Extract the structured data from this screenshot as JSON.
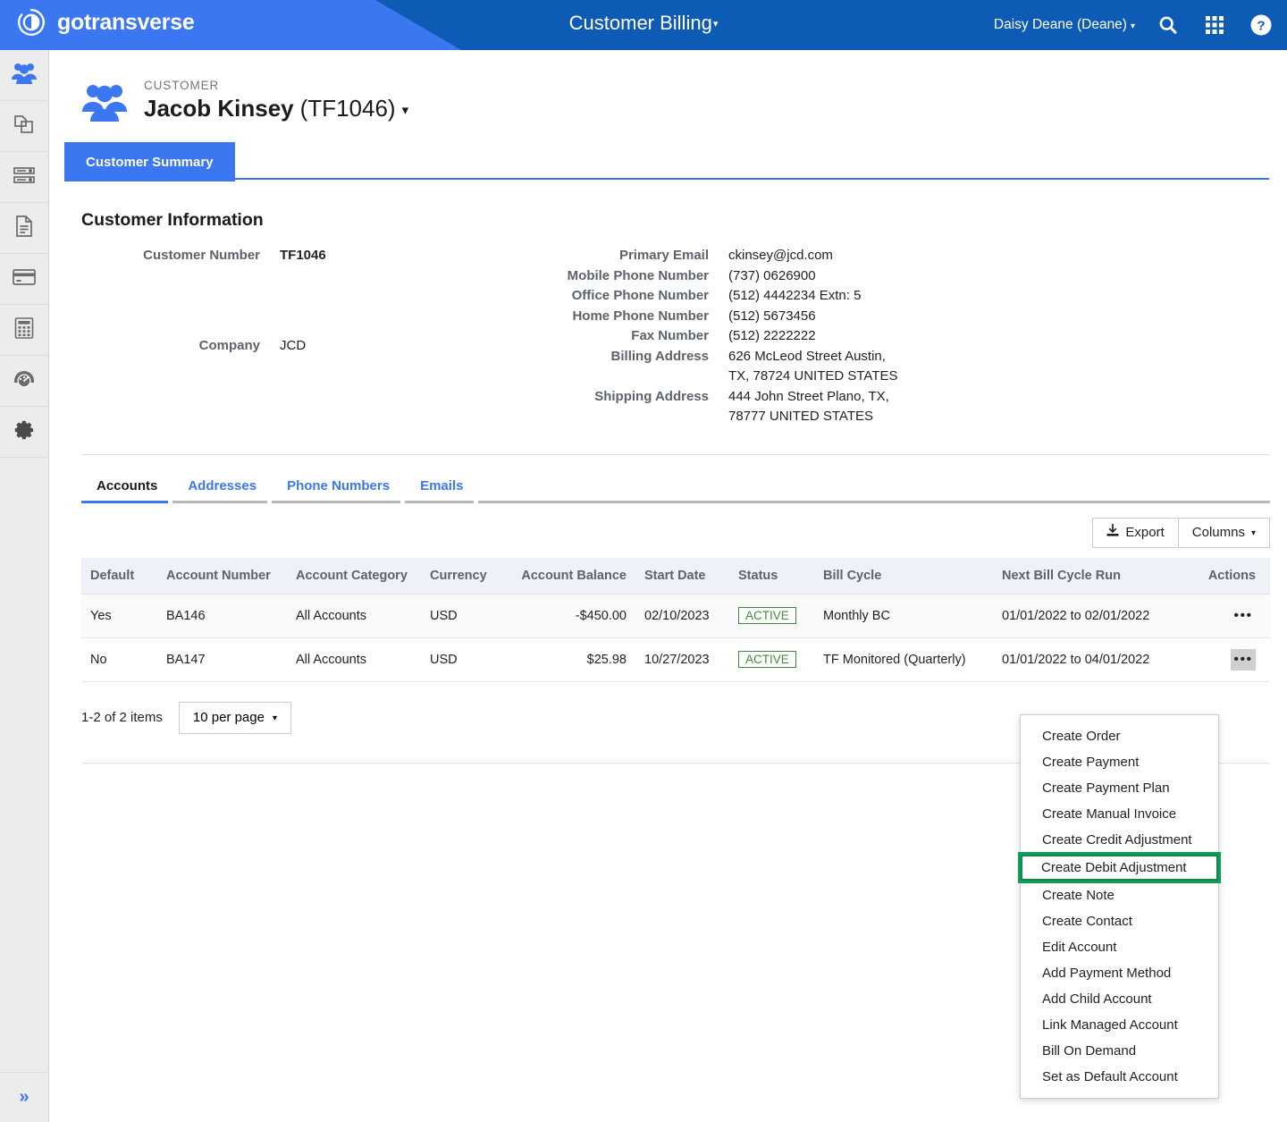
{
  "brand": {
    "name": "gotransverse",
    "logo_icon": "gotransverse-circle-logo"
  },
  "topbar": {
    "app_title": "Customer Billing",
    "app_title_caret": "▾",
    "user": "Daisy Deane (Deane)",
    "user_caret": "▾",
    "icons": [
      "search-icon",
      "apps-grid-icon",
      "help-icon"
    ],
    "colors": {
      "left_wedge": "#3b77f0",
      "right": "#0d5bb5"
    }
  },
  "rail": {
    "items": [
      {
        "name": "customers",
        "icon": "people-icon",
        "active": true
      },
      {
        "name": "products",
        "icon": "copy-documents-icon",
        "active": false
      },
      {
        "name": "billing",
        "icon": "server-stack-icon",
        "active": false
      },
      {
        "name": "invoices",
        "icon": "document-icon",
        "active": false
      },
      {
        "name": "payments",
        "icon": "credit-card-icon",
        "active": false
      },
      {
        "name": "accounting",
        "icon": "calculator-icon",
        "active": false
      },
      {
        "name": "reports",
        "icon": "gauge-icon",
        "active": false
      },
      {
        "name": "settings",
        "icon": "gear-icon",
        "active": false
      }
    ],
    "expand_glyph": "»"
  },
  "customer": {
    "eyebrow": "CUSTOMER",
    "name": "Jacob Kinsey",
    "number_paren": "(TF1046)",
    "caret": "▾",
    "avatar_icon": "people-icon"
  },
  "main_tab": {
    "label": "Customer Summary"
  },
  "info": {
    "heading": "Customer Information",
    "left": [
      {
        "label": "Customer Number",
        "value": "TF1046",
        "bold": true
      },
      {
        "label": "Company",
        "value": "JCD",
        "bold": false
      }
    ],
    "right": [
      {
        "label": "Primary Email",
        "value": "ckinsey@jcd.com"
      },
      {
        "label": "Mobile Phone Number",
        "value": "(737) 0626900"
      },
      {
        "label": "Office Phone Number",
        "value": "(512) 4442234 Extn: 5"
      },
      {
        "label": "Home Phone Number",
        "value": "(512) 5673456"
      },
      {
        "label": "Fax Number",
        "value": "(512) 2222222"
      },
      {
        "label": "Billing Address",
        "value": "626 McLeod Street Austin, TX, 78724 UNITED STATES"
      },
      {
        "label": "Shipping Address",
        "value": "444 John Street Plano, TX, 78777 UNITED STATES"
      }
    ]
  },
  "subtabs": [
    {
      "label": "Accounts",
      "active": true
    },
    {
      "label": "Addresses",
      "active": false
    },
    {
      "label": "Phone Numbers",
      "active": false
    },
    {
      "label": "Emails",
      "active": false
    }
  ],
  "toolbar": {
    "export_label": "Export",
    "export_icon": "download-icon",
    "columns_label": "Columns",
    "columns_caret": "▾"
  },
  "table": {
    "columns": [
      "Default",
      "Account Number",
      "Account Category",
      "Currency",
      "Account Balance",
      "Start Date",
      "Status",
      "Bill Cycle",
      "Next Bill Cycle Run",
      "Actions"
    ],
    "rows": [
      {
        "default": "Yes",
        "account_number": "BA146",
        "account_category": "All Accounts",
        "currency": "USD",
        "account_balance": "-$450.00",
        "start_date": "02/10/2023",
        "status": "ACTIVE",
        "bill_cycle": "Monthly BC",
        "next_bill_cycle_run": "01/01/2022 to 02/01/2022",
        "actions_glyph": "•••",
        "actions_open": false
      },
      {
        "default": "No",
        "account_number": "BA147",
        "account_category": "All Accounts",
        "currency": "USD",
        "account_balance": "$25.98",
        "start_date": "10/27/2023",
        "status": "ACTIVE",
        "bill_cycle": "TF Monitored (Quarterly)",
        "next_bill_cycle_run": "01/01/2022 to 04/01/2022",
        "actions_glyph": "•••",
        "actions_open": true
      }
    ],
    "status_color": "#3f8a3f"
  },
  "pager": {
    "count_text": "1-2 of 2 items",
    "per_page_label": "10 per page",
    "per_page_caret": "▾"
  },
  "actions_menu": {
    "highlight_color": "#0f8a4d",
    "items": [
      {
        "label": "Create Order",
        "highlighted": false
      },
      {
        "label": "Create Payment",
        "highlighted": false
      },
      {
        "label": "Create Payment Plan",
        "highlighted": false
      },
      {
        "label": "Create Manual Invoice",
        "highlighted": false
      },
      {
        "label": "Create Credit Adjustment",
        "highlighted": false
      },
      {
        "label": "Create Debit Adjustment",
        "highlighted": true
      },
      {
        "label": "Create Note",
        "highlighted": false
      },
      {
        "label": "Create Contact",
        "highlighted": false
      },
      {
        "label": "Edit Account",
        "highlighted": false
      },
      {
        "label": "Add Payment Method",
        "highlighted": false
      },
      {
        "label": "Add Child Account",
        "highlighted": false
      },
      {
        "label": "Link Managed Account",
        "highlighted": false
      },
      {
        "label": "Bill On Demand",
        "highlighted": false
      },
      {
        "label": "Set as Default Account",
        "highlighted": false
      }
    ]
  }
}
